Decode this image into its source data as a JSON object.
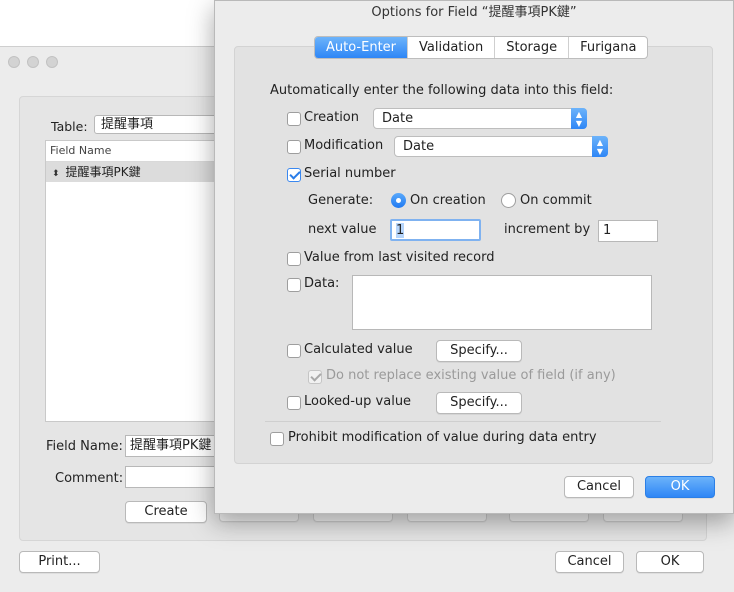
{
  "background_window": {
    "table_label": "Table:",
    "table_value": "提醒事項",
    "list_header": "Field Name",
    "list_rows": [
      {
        "icon": "sort-arrows-icon",
        "name": "提醒事項PK鍵"
      }
    ],
    "field_name_label": "Field Name:",
    "field_name_value": "提醒事項PK鍵",
    "comment_label": "Comment:",
    "comment_value": "",
    "create_button": "Create",
    "print_button": "Print...",
    "cancel_button": "Cancel",
    "ok_button": "OK"
  },
  "dialog": {
    "title": "Options for Field “提醒事項PK鍵”",
    "tabs": [
      {
        "label": "Auto-Enter",
        "active": true
      },
      {
        "label": "Validation",
        "active": false
      },
      {
        "label": "Storage",
        "active": false
      },
      {
        "label": "Furigana",
        "active": false
      }
    ],
    "intro": "Automatically enter the following data into this field:",
    "creation": {
      "label": "Creation",
      "checked": false,
      "select_value": "Date"
    },
    "modification": {
      "label": "Modification",
      "checked": false,
      "select_value": "Date"
    },
    "serial": {
      "label": "Serial number",
      "checked": true,
      "generate_label": "Generate:",
      "on_creation_label": "On creation",
      "on_commit_label": "On commit",
      "selected": "on_creation",
      "next_value_label": "next value",
      "next_value": "1",
      "increment_label": "increment by",
      "increment_value": "1"
    },
    "last_visited": {
      "label": "Value from last visited record",
      "checked": false
    },
    "data_option": {
      "label": "Data:",
      "checked": false,
      "value": ""
    },
    "calculated": {
      "label": "Calculated value",
      "checked": false,
      "specify_label": "Specify..."
    },
    "do_not_replace": {
      "label": "Do not replace existing value of field (if any)",
      "checked": true,
      "disabled": true
    },
    "looked_up": {
      "label": "Looked-up value",
      "checked": false,
      "specify_label": "Specify..."
    },
    "prohibit": {
      "label": "Prohibit modification of value during data entry",
      "checked": false
    },
    "cancel_button": "Cancel",
    "ok_button": "OK"
  },
  "colors": {
    "accent": "#2e86f6",
    "window_bg": "#ececec"
  }
}
